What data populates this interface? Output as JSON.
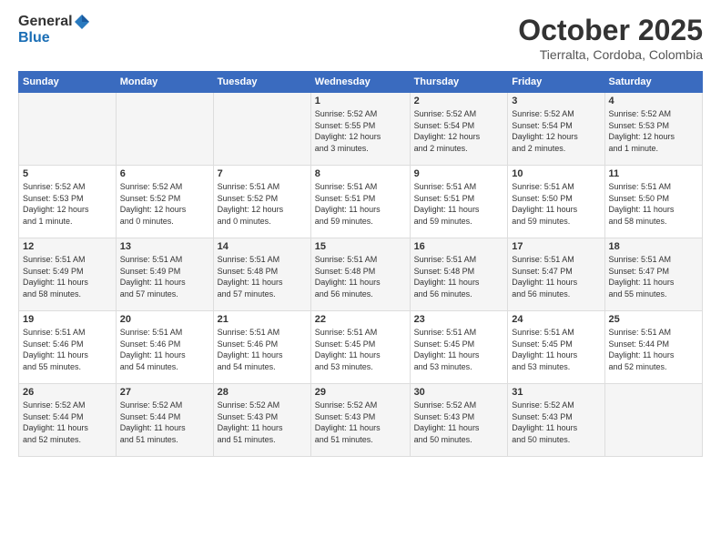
{
  "header": {
    "logo_general": "General",
    "logo_blue": "Blue",
    "month_title": "October 2025",
    "location": "Tierralta, Cordoba, Colombia"
  },
  "days_of_week": [
    "Sunday",
    "Monday",
    "Tuesday",
    "Wednesday",
    "Thursday",
    "Friday",
    "Saturday"
  ],
  "weeks": [
    {
      "days": [
        {
          "num": "",
          "info": ""
        },
        {
          "num": "",
          "info": ""
        },
        {
          "num": "",
          "info": ""
        },
        {
          "num": "1",
          "info": "Sunrise: 5:52 AM\nSunset: 5:55 PM\nDaylight: 12 hours\nand 3 minutes."
        },
        {
          "num": "2",
          "info": "Sunrise: 5:52 AM\nSunset: 5:54 PM\nDaylight: 12 hours\nand 2 minutes."
        },
        {
          "num": "3",
          "info": "Sunrise: 5:52 AM\nSunset: 5:54 PM\nDaylight: 12 hours\nand 2 minutes."
        },
        {
          "num": "4",
          "info": "Sunrise: 5:52 AM\nSunset: 5:53 PM\nDaylight: 12 hours\nand 1 minute."
        }
      ]
    },
    {
      "days": [
        {
          "num": "5",
          "info": "Sunrise: 5:52 AM\nSunset: 5:53 PM\nDaylight: 12 hours\nand 1 minute."
        },
        {
          "num": "6",
          "info": "Sunrise: 5:52 AM\nSunset: 5:52 PM\nDaylight: 12 hours\nand 0 minutes."
        },
        {
          "num": "7",
          "info": "Sunrise: 5:51 AM\nSunset: 5:52 PM\nDaylight: 12 hours\nand 0 minutes."
        },
        {
          "num": "8",
          "info": "Sunrise: 5:51 AM\nSunset: 5:51 PM\nDaylight: 11 hours\nand 59 minutes."
        },
        {
          "num": "9",
          "info": "Sunrise: 5:51 AM\nSunset: 5:51 PM\nDaylight: 11 hours\nand 59 minutes."
        },
        {
          "num": "10",
          "info": "Sunrise: 5:51 AM\nSunset: 5:50 PM\nDaylight: 11 hours\nand 59 minutes."
        },
        {
          "num": "11",
          "info": "Sunrise: 5:51 AM\nSunset: 5:50 PM\nDaylight: 11 hours\nand 58 minutes."
        }
      ]
    },
    {
      "days": [
        {
          "num": "12",
          "info": "Sunrise: 5:51 AM\nSunset: 5:49 PM\nDaylight: 11 hours\nand 58 minutes."
        },
        {
          "num": "13",
          "info": "Sunrise: 5:51 AM\nSunset: 5:49 PM\nDaylight: 11 hours\nand 57 minutes."
        },
        {
          "num": "14",
          "info": "Sunrise: 5:51 AM\nSunset: 5:48 PM\nDaylight: 11 hours\nand 57 minutes."
        },
        {
          "num": "15",
          "info": "Sunrise: 5:51 AM\nSunset: 5:48 PM\nDaylight: 11 hours\nand 56 minutes."
        },
        {
          "num": "16",
          "info": "Sunrise: 5:51 AM\nSunset: 5:48 PM\nDaylight: 11 hours\nand 56 minutes."
        },
        {
          "num": "17",
          "info": "Sunrise: 5:51 AM\nSunset: 5:47 PM\nDaylight: 11 hours\nand 56 minutes."
        },
        {
          "num": "18",
          "info": "Sunrise: 5:51 AM\nSunset: 5:47 PM\nDaylight: 11 hours\nand 55 minutes."
        }
      ]
    },
    {
      "days": [
        {
          "num": "19",
          "info": "Sunrise: 5:51 AM\nSunset: 5:46 PM\nDaylight: 11 hours\nand 55 minutes."
        },
        {
          "num": "20",
          "info": "Sunrise: 5:51 AM\nSunset: 5:46 PM\nDaylight: 11 hours\nand 54 minutes."
        },
        {
          "num": "21",
          "info": "Sunrise: 5:51 AM\nSunset: 5:46 PM\nDaylight: 11 hours\nand 54 minutes."
        },
        {
          "num": "22",
          "info": "Sunrise: 5:51 AM\nSunset: 5:45 PM\nDaylight: 11 hours\nand 53 minutes."
        },
        {
          "num": "23",
          "info": "Sunrise: 5:51 AM\nSunset: 5:45 PM\nDaylight: 11 hours\nand 53 minutes."
        },
        {
          "num": "24",
          "info": "Sunrise: 5:51 AM\nSunset: 5:45 PM\nDaylight: 11 hours\nand 53 minutes."
        },
        {
          "num": "25",
          "info": "Sunrise: 5:51 AM\nSunset: 5:44 PM\nDaylight: 11 hours\nand 52 minutes."
        }
      ]
    },
    {
      "days": [
        {
          "num": "26",
          "info": "Sunrise: 5:52 AM\nSunset: 5:44 PM\nDaylight: 11 hours\nand 52 minutes."
        },
        {
          "num": "27",
          "info": "Sunrise: 5:52 AM\nSunset: 5:44 PM\nDaylight: 11 hours\nand 51 minutes."
        },
        {
          "num": "28",
          "info": "Sunrise: 5:52 AM\nSunset: 5:43 PM\nDaylight: 11 hours\nand 51 minutes."
        },
        {
          "num": "29",
          "info": "Sunrise: 5:52 AM\nSunset: 5:43 PM\nDaylight: 11 hours\nand 51 minutes."
        },
        {
          "num": "30",
          "info": "Sunrise: 5:52 AM\nSunset: 5:43 PM\nDaylight: 11 hours\nand 50 minutes."
        },
        {
          "num": "31",
          "info": "Sunrise: 5:52 AM\nSunset: 5:43 PM\nDaylight: 11 hours\nand 50 minutes."
        },
        {
          "num": "",
          "info": ""
        }
      ]
    }
  ]
}
